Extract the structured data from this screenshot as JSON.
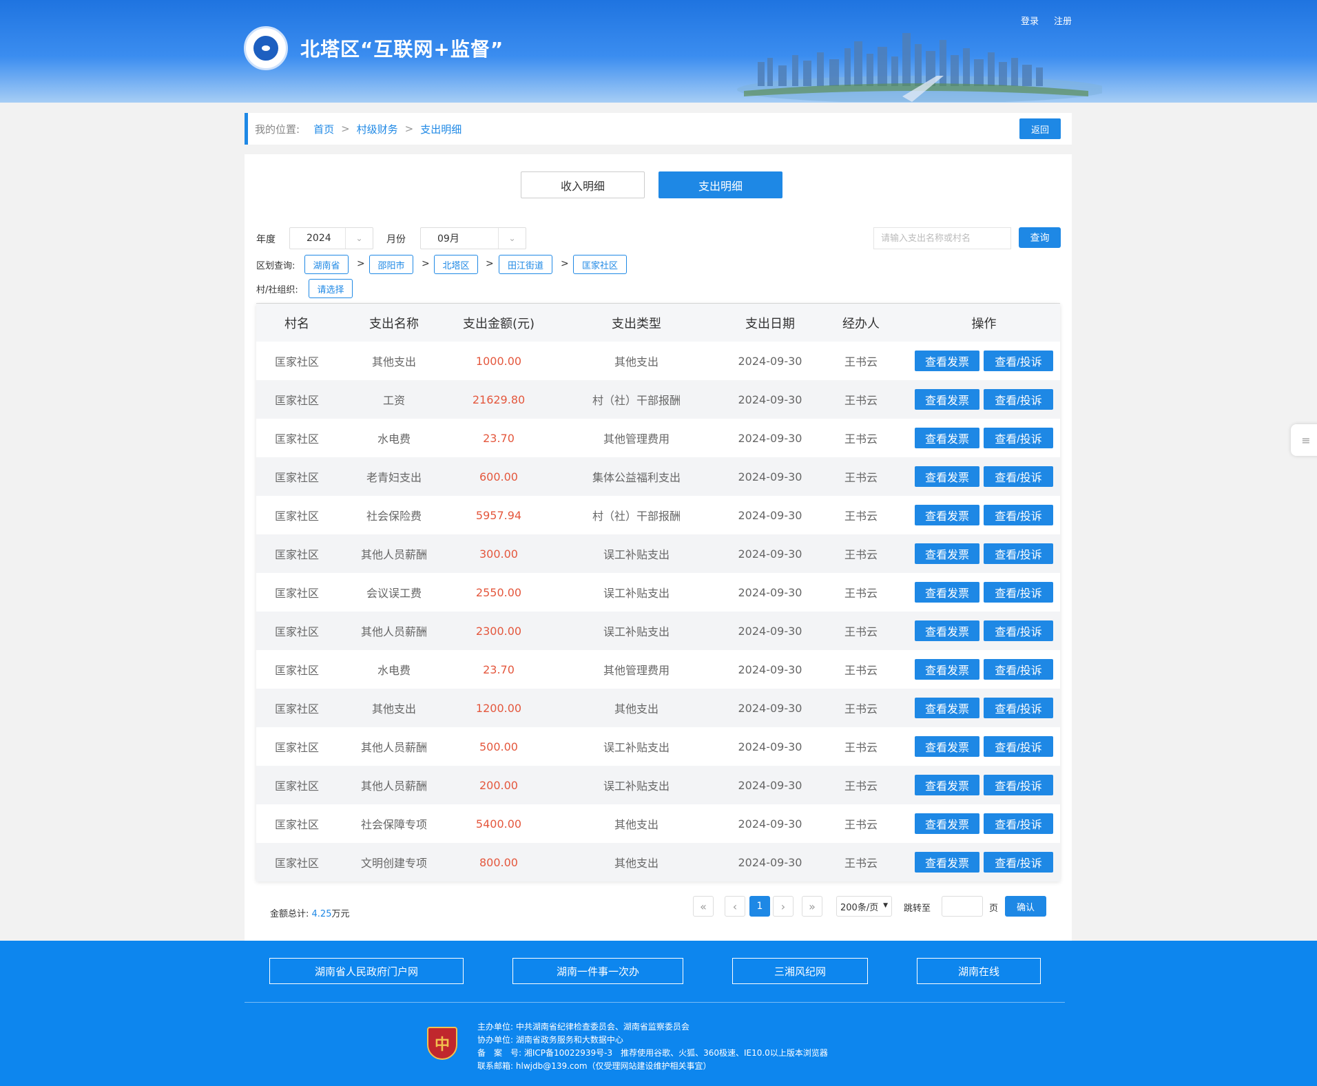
{
  "header": {
    "title": "北塔区“互联网+监督”",
    "login": "登录",
    "register": "注册"
  },
  "breadcrumb": {
    "label": "我的位置:",
    "items": [
      "首页",
      "村级财务",
      "支出明细"
    ],
    "separator": ">",
    "back": "返回"
  },
  "tabs": {
    "income": "收入明细",
    "expense": "支出明细"
  },
  "filters": {
    "year_label": "年度",
    "year_value": "2024",
    "month_label": "月份",
    "month_value": "09月",
    "search_placeholder": "请输入支出名称或村名",
    "query": "查询",
    "region_label": "区划查询:",
    "regions": [
      "湖南省",
      "邵阳市",
      "北塔区",
      "田江街道",
      "匡家社区"
    ],
    "org_label": "村/社组织:",
    "org_value": "请选择"
  },
  "table": {
    "headers": [
      "村名",
      "支出名称",
      "支出金额(元)",
      "支出类型",
      "支出日期",
      "经办人",
      "操作"
    ],
    "action_invoice": "查看发票",
    "action_complain": "查看/投诉",
    "rows": [
      {
        "village": "匡家社区",
        "name": "其他支出",
        "amount": "1000.00",
        "type": "其他支出",
        "date": "2024-09-30",
        "handler": "王书云"
      },
      {
        "village": "匡家社区",
        "name": "工资",
        "amount": "21629.80",
        "type": "村（社）干部报酬",
        "date": "2024-09-30",
        "handler": "王书云"
      },
      {
        "village": "匡家社区",
        "name": "水电费",
        "amount": "23.70",
        "type": "其他管理费用",
        "date": "2024-09-30",
        "handler": "王书云"
      },
      {
        "village": "匡家社区",
        "name": "老青妇支出",
        "amount": "600.00",
        "type": "集体公益福利支出",
        "date": "2024-09-30",
        "handler": "王书云"
      },
      {
        "village": "匡家社区",
        "name": "社会保险费",
        "amount": "5957.94",
        "type": "村（社）干部报酬",
        "date": "2024-09-30",
        "handler": "王书云"
      },
      {
        "village": "匡家社区",
        "name": "其他人员薪酬",
        "amount": "300.00",
        "type": "误工补贴支出",
        "date": "2024-09-30",
        "handler": "王书云"
      },
      {
        "village": "匡家社区",
        "name": "会议误工费",
        "amount": "2550.00",
        "type": "误工补贴支出",
        "date": "2024-09-30",
        "handler": "王书云"
      },
      {
        "village": "匡家社区",
        "name": "其他人员薪酬",
        "amount": "2300.00",
        "type": "误工补贴支出",
        "date": "2024-09-30",
        "handler": "王书云"
      },
      {
        "village": "匡家社区",
        "name": "水电费",
        "amount": "23.70",
        "type": "其他管理费用",
        "date": "2024-09-30",
        "handler": "王书云"
      },
      {
        "village": "匡家社区",
        "name": "其他支出",
        "amount": "1200.00",
        "type": "其他支出",
        "date": "2024-09-30",
        "handler": "王书云"
      },
      {
        "village": "匡家社区",
        "name": "其他人员薪酬",
        "amount": "500.00",
        "type": "误工补贴支出",
        "date": "2024-09-30",
        "handler": "王书云"
      },
      {
        "village": "匡家社区",
        "name": "其他人员薪酬",
        "amount": "200.00",
        "type": "误工补贴支出",
        "date": "2024-09-30",
        "handler": "王书云"
      },
      {
        "village": "匡家社区",
        "name": "社会保障专项",
        "amount": "5400.00",
        "type": "其他支出",
        "date": "2024-09-30",
        "handler": "王书云"
      },
      {
        "village": "匡家社区",
        "name": "文明创建专项",
        "amount": "800.00",
        "type": "其他支出",
        "date": "2024-09-30",
        "handler": "王书云"
      }
    ]
  },
  "summary": {
    "label": "金额总计:",
    "value": "4.25",
    "unit": "万元"
  },
  "pagination": {
    "first": "«",
    "prev": "‹",
    "current": "1",
    "next": "›",
    "last": "»",
    "page_size": "200条/页",
    "jump_label": "跳转至",
    "page_label": "页",
    "confirm": "确认"
  },
  "footer": {
    "links": [
      "湖南省人民政府门户网",
      "湖南一件事一次办",
      "三湘风纪网",
      "湖南在线"
    ],
    "emblem_text": "党政机关",
    "info": [
      {
        "label": "主办单位:",
        "value": "中共湖南省纪律检查委员会、湖南省监察委员会"
      },
      {
        "label": "协办单位:",
        "value": "湖南省政务服务和大数据中心"
      },
      {
        "label": "备　案　号:",
        "value": "湘ICP备10022939号-3　推荐使用谷歌、火狐、360极速、IE10.0以上版本浏览器"
      },
      {
        "label": "联系邮箱:",
        "value": "hlwjdb@139.com（仅受理网站建设维护相关事宜）"
      }
    ]
  },
  "colors": {
    "primary": "#1e88e5",
    "amount": "#e4573d",
    "footer": "#0d86ee"
  }
}
